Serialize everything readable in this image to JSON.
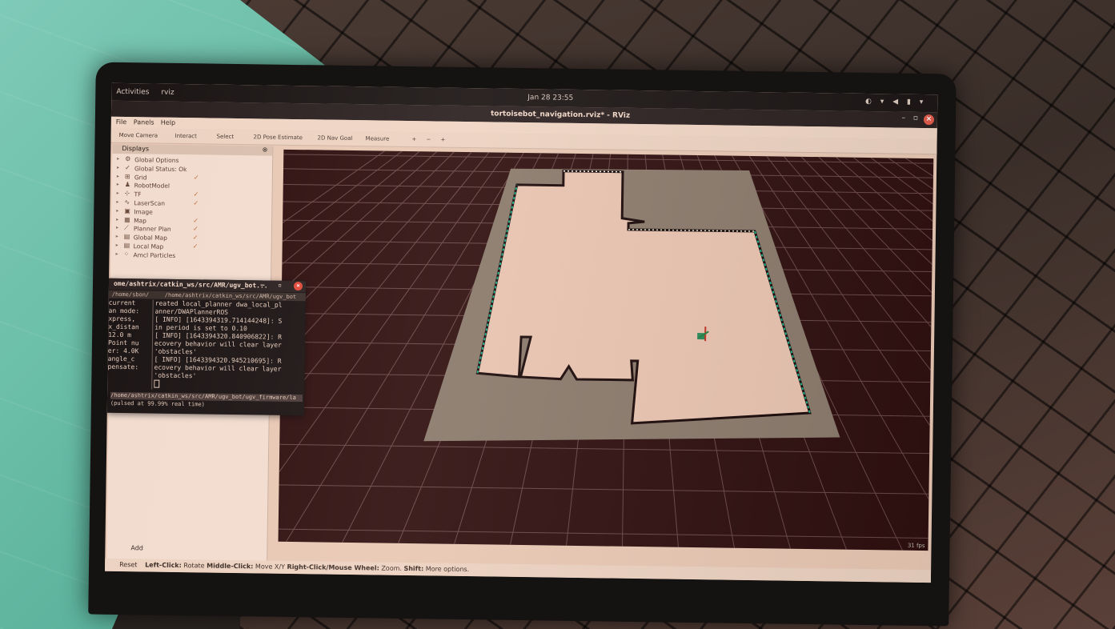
{
  "topbar": {
    "activities": "Activities",
    "app": "rviz",
    "clock": "Jan 28  23:55",
    "tray": "◐ ▾ ◀ ▮ ▾"
  },
  "window": {
    "title": "tortoisebot_navigation.rviz* - RViz"
  },
  "menu": [
    "File",
    "Panels",
    "Help"
  ],
  "toolbar": [
    "Move Camera",
    "Interact",
    "Select",
    "2D Pose Estimate",
    "2D Nav Goal",
    "Measure",
    "+",
    "−",
    "+"
  ],
  "displays": {
    "header": "Displays",
    "items": [
      {
        "name": "Global Options",
        "icon": "gear-icon",
        "checked": ""
      },
      {
        "name": "Global Status: Ok",
        "icon": "check-icon",
        "checked": ""
      },
      {
        "name": "Grid",
        "icon": "grid-icon",
        "checked": "✓"
      },
      {
        "name": "RobotModel",
        "icon": "robot-icon",
        "checked": ""
      },
      {
        "name": "TF",
        "icon": "tf-icon",
        "checked": "✓"
      },
      {
        "name": "LaserScan",
        "icon": "laser-icon",
        "checked": "✓"
      },
      {
        "name": "Image",
        "icon": "image-icon",
        "checked": ""
      },
      {
        "name": "Map",
        "icon": "map-icon",
        "checked": "✓"
      },
      {
        "name": "Planner Plan",
        "icon": "path-icon",
        "checked": "✓"
      },
      {
        "name": "Global Map",
        "icon": "folder-icon",
        "checked": "✓"
      },
      {
        "name": "Local Map",
        "icon": "folder-icon",
        "checked": "✓"
      },
      {
        "name": "Amcl Particles",
        "icon": "particles-icon",
        "checked": ""
      }
    ],
    "add_label": "Add"
  },
  "terminal": {
    "title": "ome/ashtrix/catkin_ws/src/AMR/ugv_bot...",
    "tab1": "/home/sbon/",
    "tab2": "/home/ashtrix/catkin_ws/src/AMR/ugv_bot",
    "left_lines": [
      "current",
      "an mode:",
      "xpress,",
      "x_distan",
      " 12.0 m",
      "Point nu",
      "er: 4.0K",
      " angle_c",
      "pensate:"
    ],
    "right_lines": [
      "reated local_planner dwa_local_pl",
      "anner/DWAPlannerROS",
      "[ INFO] [1643394319.714144248]: S",
      "in period is set to 0.10",
      "[ INFO] [1643394320.840906822]: R",
      "ecovery behavior will clear layer",
      " 'obstacles'",
      "[ INFO] [1643394320.945210695]: R",
      "ecovery behavior will clear layer",
      " 'obstacles'"
    ],
    "bottom_path": "/home/ashtrix/catkin_ws/src/AMR/ugv_bot/ugv_firmware/la",
    "bottom_status": "(pulsed at 99.99% real time)"
  },
  "viewport": {
    "fps": "31 fps"
  },
  "status": {
    "reset": "Reset",
    "left_click_key": "Left-Click:",
    "left_click_val": "Rotate",
    "middle_key": "Middle-Click:",
    "middle_val": "Move X/Y",
    "right_key": "Right-Click/Mouse Wheel:",
    "right_val": "Zoom.",
    "shift_key": "Shift:",
    "shift_val": "More options."
  }
}
